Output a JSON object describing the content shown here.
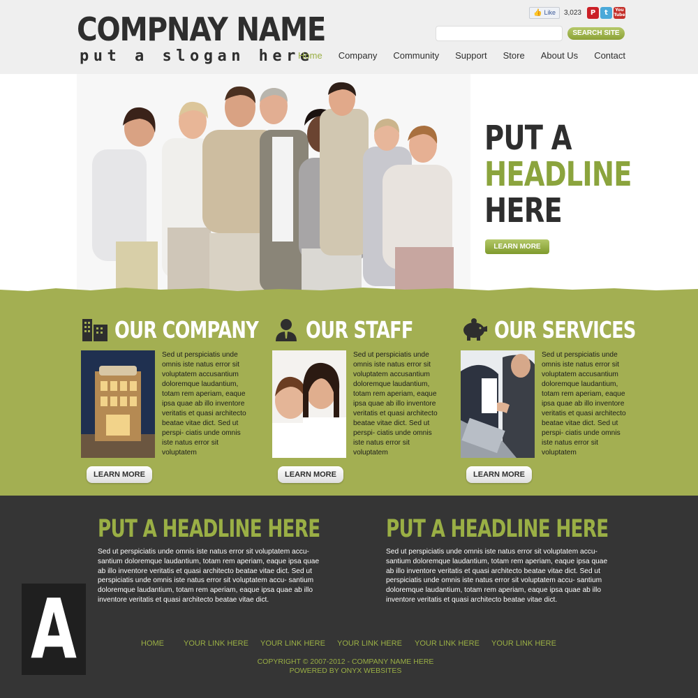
{
  "header": {
    "logo_name": "COMPNAY NAME",
    "logo_slogan": "put a slogan here",
    "like_label": "Like",
    "like_count": "3,023",
    "search_placeholder": "",
    "search_button": "SEARCH SITE",
    "social_icons": [
      "pinterest-icon",
      "twitter-icon",
      "youtube-icon"
    ],
    "youtube_text_top": "You",
    "youtube_text_bottom": "Tube",
    "nav": [
      "Home",
      "Company",
      "Community",
      "Support",
      "Store",
      "About Us",
      "Contact"
    ],
    "active_nav": "Home"
  },
  "hero": {
    "headline_line1": "PUT A",
    "headline_line2": "HEADLINE",
    "headline_line3": "HERE",
    "button": "LEARN MORE"
  },
  "columns": [
    {
      "title": "OUR COMPANY",
      "icon": "buildings-icon",
      "text": "Sed ut perspiciatis unde omnis iste natus error sit voluptatem accusantium doloremque laudantium, totam rem aperiam, eaque ipsa quae ab illo inventore veritatis et quasi architecto beatae vitae dict. Sed ut perspi- ciatis unde omnis iste natus error sit voluptatem",
      "button": "LEARN MORE"
    },
    {
      "title": "OUR STAFF",
      "icon": "staff-person-icon",
      "text": "Sed ut perspiciatis unde omnis iste natus error sit voluptatem accusantium doloremque laudantium, totam rem aperiam, eaque ipsa quae ab illo inventore veritatis et quasi architecto beatae vitae dict. Sed ut perspi- ciatis unde omnis iste natus error sit voluptatem",
      "button": "LEARN MORE"
    },
    {
      "title": "OUR SERVICES",
      "icon": "piggy-bank-icon",
      "text": "Sed ut perspiciatis unde omnis iste natus error sit voluptatem accusantium doloremque laudantium, totam rem aperiam, eaque ipsa quae ab illo inventore veritatis et quasi architecto beatae vitae dict. Sed ut perspi- ciatis unde omnis iste natus error sit voluptatem",
      "button": "LEARN MORE"
    }
  ],
  "bottom": [
    {
      "headline": "PUT A HEADLINE HERE",
      "text": "Sed ut perspiciatis unde omnis iste natus error sit voluptatem accu- santium doloremque laudantium, totam rem aperiam, eaque ipsa quae ab illo inventore veritatis et quasi architecto beatae vitae dict. Sed ut perspiciatis unde omnis iste natus error sit voluptatem accu- santium doloremque laudantium, totam rem aperiam, eaque ipsa quae ab illo inventore veritatis et quasi architecto beatae vitae dict."
    },
    {
      "headline": "PUT A HEADLINE HERE",
      "text": "Sed ut perspiciatis unde omnis iste natus error sit voluptatem accu- santium doloremque laudantium, totam rem aperiam, eaque ipsa quae ab illo inventore veritatis et quasi architecto beatae vitae dict. Sed ut perspiciatis unde omnis iste natus error sit voluptatem accu- santium doloremque laudantium, totam rem aperiam, eaque ipsa quae ab illo inventore veritatis et quasi architecto beatae vitae dict."
    }
  ],
  "footer": {
    "links": [
      "HOME",
      "YOUR LINK HERE",
      "YOUR LINK HERE",
      "YOUR LINK HERE",
      "YOUR LINK HERE",
      "YOUR LINK HERE"
    ],
    "copyright": "COPYRIGHT © 2007-2012 - COMPANY NAME HERE",
    "powered_by": "POWERED BY ONYX WEBSITES"
  },
  "badge": {
    "letter": "A"
  },
  "colors": {
    "accent_green": "#9aaf45",
    "band_green": "#a3af52",
    "dark_bg": "#353535",
    "header_bg": "#efefef",
    "text_dark": "#2e2e2e"
  }
}
